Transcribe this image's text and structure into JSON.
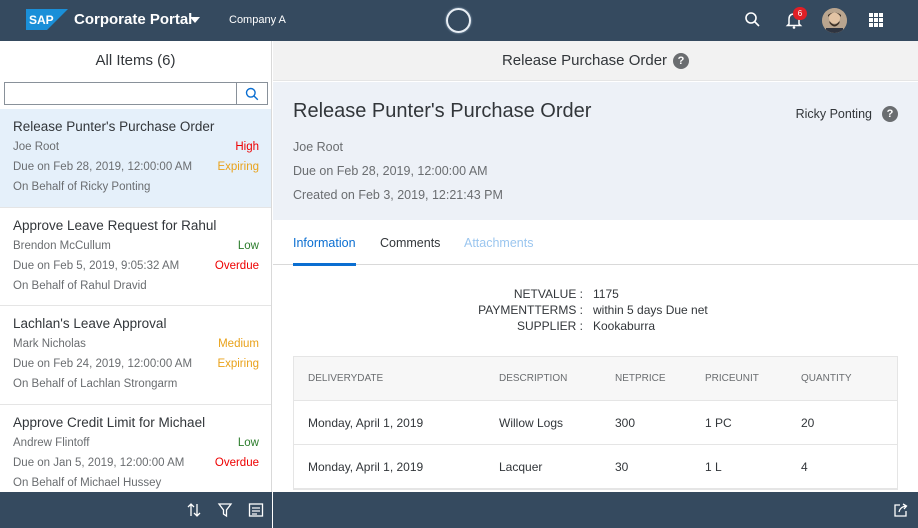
{
  "shell": {
    "logo_text": "SAP",
    "title": "Corporate Portal",
    "company": "Company A",
    "notification_count": "6"
  },
  "master": {
    "title": "All Items (6)",
    "search_value": "",
    "items": [
      {
        "title": "Release Punter's Purchase Order",
        "person": "Joe Root",
        "priority": "High",
        "due": "Due on Feb 28, 2019, 12:00:00 AM",
        "status": "Expiring",
        "behalf": "On Behalf of Ricky Ponting"
      },
      {
        "title": "Approve Leave Request for Rahul",
        "person": "Brendon McCullum",
        "priority": "Low",
        "due": "Due on Feb 5, 2019, 9:05:32 AM",
        "status": "Overdue",
        "behalf": "On Behalf of Rahul Dravid"
      },
      {
        "title": "Lachlan's Leave Approval",
        "person": "Mark Nicholas",
        "priority": "Medium",
        "due": "Due on Feb 24, 2019, 12:00:00 AM",
        "status": "Expiring",
        "behalf": "On Behalf of Lachlan Strongarm"
      },
      {
        "title": "Approve Credit Limit for Michael",
        "person": "Andrew Flintoff",
        "priority": "Low",
        "due": "Due on Jan 5, 2019, 12:00:00 AM",
        "status": "Overdue",
        "behalf": "On Behalf of Michael Hussey"
      }
    ]
  },
  "detail": {
    "bar_title": "Release Purchase Order",
    "title": "Release Punter's Purchase Order",
    "owner": "Ricky Ponting",
    "person": "Joe Root",
    "due": "Due on Feb 28, 2019, 12:00:00 AM",
    "created": "Created on Feb 3, 2019, 12:21:43 PM",
    "tabs": [
      "Information",
      "Comments",
      "Attachments"
    ],
    "fields": [
      {
        "label": "NETVALUE :",
        "value": "1175"
      },
      {
        "label": "PAYMENTTERMS :",
        "value": "within 5 days Due net"
      },
      {
        "label": "SUPPLIER :",
        "value": "Kookaburra"
      }
    ],
    "table": {
      "headers": [
        "DELIVERYDATE",
        "DESCRIPTION",
        "NETPRICE",
        "PRICEUNIT",
        "QUANTITY"
      ],
      "rows": [
        [
          "Monday, April 1, 2019",
          "Willow Logs",
          "300",
          "1 PC",
          "20"
        ],
        [
          "Monday, April 1, 2019",
          "Lacquer",
          "30",
          "1 L",
          "4"
        ]
      ]
    }
  },
  "colors": {
    "shell_bg": "#354a5f",
    "accent": "#0a6ed1",
    "selected_bg": "#e5f0fa",
    "high_overdue": "#e00000",
    "medium_expiring": "#e9a21a",
    "low": "#2b7c2b"
  }
}
